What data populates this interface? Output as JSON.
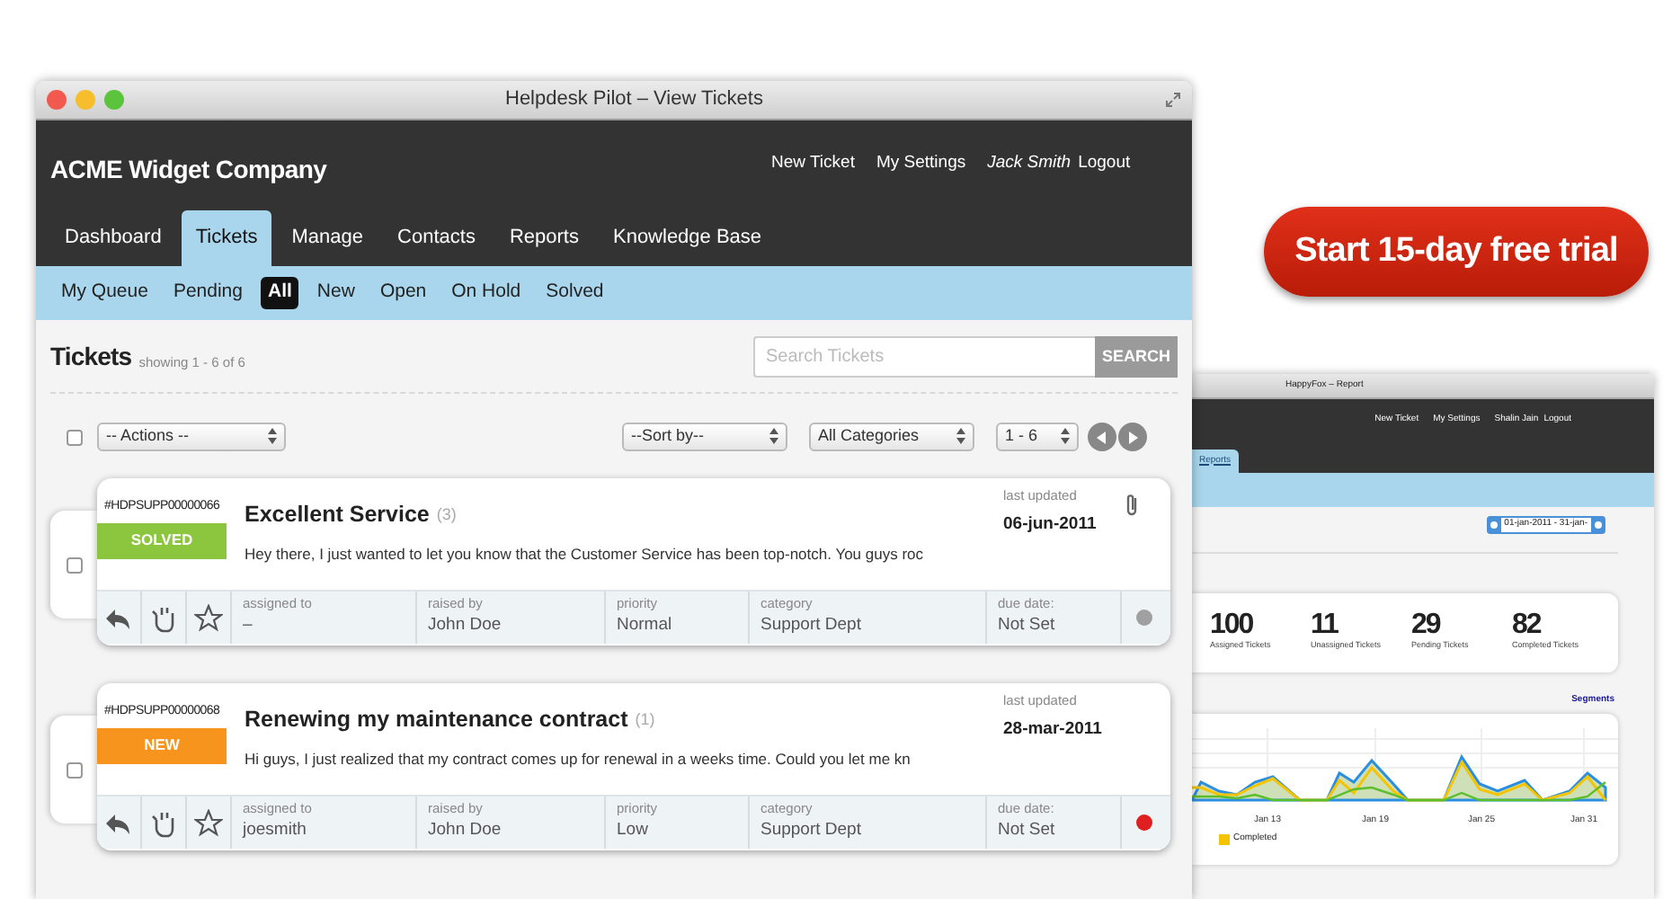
{
  "trial_button": {
    "label": "Start 15-day free trial"
  },
  "main_window": {
    "title": "Helpdesk Pilot – View Tickets",
    "brand": "ACME Widget Company",
    "header_links": [
      {
        "kind": "link",
        "label": "New Ticket"
      },
      {
        "kind": "link",
        "label": "My Settings"
      },
      {
        "kind": "user",
        "label": "Jack Smith"
      },
      {
        "kind": "link",
        "label": "Logout"
      }
    ],
    "tabs": [
      {
        "label": "Dashboard",
        "selected": false
      },
      {
        "label": "Tickets",
        "selected": true
      },
      {
        "label": "Manage",
        "selected": false
      },
      {
        "label": "Contacts",
        "selected": false
      },
      {
        "label": "Reports",
        "selected": false
      },
      {
        "label": "Knowledge Base",
        "selected": false
      }
    ],
    "subtabs": [
      {
        "label": "My Queue",
        "selected": false
      },
      {
        "label": "Pending",
        "selected": false
      },
      {
        "label": "All",
        "selected": true
      },
      {
        "label": "New",
        "selected": false
      },
      {
        "label": "Open",
        "selected": false
      },
      {
        "label": "On Hold",
        "selected": false
      },
      {
        "label": "Solved",
        "selected": false
      }
    ],
    "heading": "Tickets",
    "showing": "showing 1 - 6 of 6",
    "search": {
      "placeholder": "Search Tickets",
      "button": "SEARCH"
    },
    "select_all": {
      "checked": false
    },
    "actions": "-- Actions --",
    "sort": "--Sort by--",
    "category": "All Categories",
    "range": "1 - 6",
    "tickets": [
      {
        "id": "#HDPSUPP00000066",
        "status": {
          "label": "SOLVED",
          "color": "#8cc63f"
        },
        "title": "Excellent Service",
        "count": "(3)",
        "excerpt": "Hey there, I just wanted to let you know that the Customer Service has been top-notch. You guys roc",
        "updated_label": "last updated",
        "updated": "06-jun-2011",
        "attachment": true,
        "checked": false,
        "fields": [
          {
            "label": "assigned to",
            "value": "–"
          },
          {
            "label": "raised by",
            "value": "John Doe"
          },
          {
            "label": "priority",
            "value": "Normal"
          },
          {
            "label": "category",
            "value": "Support Dept"
          },
          {
            "label": "due date:",
            "value": "Not Set"
          }
        ],
        "dot": {
          "color": "#a0a0a0"
        }
      },
      {
        "id": "#HDPSUPP00000068",
        "status": {
          "label": "NEW",
          "color": "#f7941d"
        },
        "title": "Renewing my maintenance contract",
        "count": "(1)",
        "excerpt": "Hi guys, I just realized that my contract comes up for renewal in a weeks time. Could you let me kn",
        "updated_label": "last updated",
        "updated": "28-mar-2011",
        "attachment": false,
        "checked": false,
        "fields": [
          {
            "label": "assigned to",
            "value": "joesmith"
          },
          {
            "label": "raised by",
            "value": "John Doe"
          },
          {
            "label": "priority",
            "value": "Low"
          },
          {
            "label": "category",
            "value": "Support Dept"
          },
          {
            "label": "due date:",
            "value": "Not Set"
          }
        ],
        "dot": {
          "color": "#e02020"
        }
      }
    ]
  },
  "report_window": {
    "title": "HappyFox – Report",
    "header_links": [
      "New Ticket",
      "My Settings",
      "Shalin Jain",
      "Logout"
    ],
    "tabs": [
      {
        "label": "Reports",
        "selected": true
      }
    ],
    "date_range": "01-jan-2011 - 31-jan-",
    "stats": [
      {
        "value": "100",
        "label": "Assigned Tickets"
      },
      {
        "value": "11",
        "label": "Unassigned Tickets"
      },
      {
        "value": "29",
        "label": "Pending Tickets"
      },
      {
        "value": "82",
        "label": "Completed Tickets"
      }
    ],
    "segments_link": "Segments",
    "chart": {
      "x_labels": [
        "Jan 13",
        "Jan 19",
        "Jan 25",
        "Jan 31"
      ],
      "legend": [
        {
          "label": "Completed",
          "checked": true,
          "color": "#f5c400"
        }
      ]
    }
  }
}
